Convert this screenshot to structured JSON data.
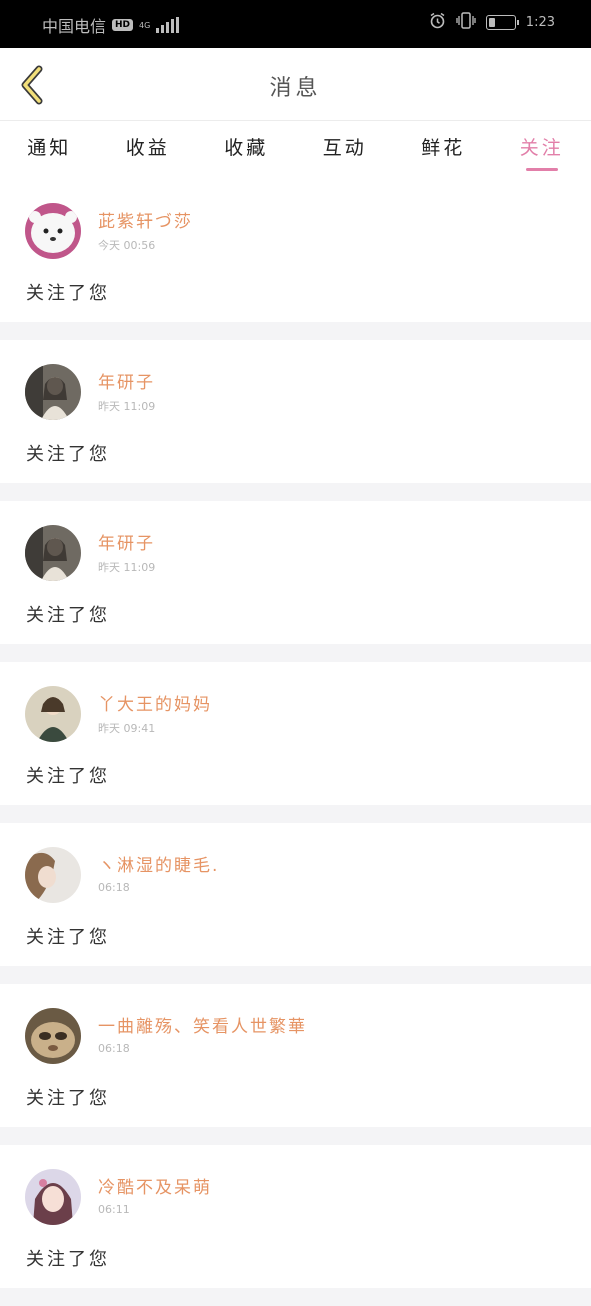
{
  "status_bar": {
    "carrier": "中国电信",
    "hd_badge": "HD",
    "network": "4G",
    "time": "1:23",
    "battery_level": 0.25
  },
  "header": {
    "title": "消息",
    "back_icon": "chevron-left-icon"
  },
  "tabs": [
    {
      "label": "通知",
      "active": false
    },
    {
      "label": "收益",
      "active": false
    },
    {
      "label": "收藏",
      "active": false
    },
    {
      "label": "互动",
      "active": false
    },
    {
      "label": "鲜花",
      "active": false
    },
    {
      "label": "关注",
      "active": true
    }
  ],
  "notifications": [
    {
      "name": "茈紫轩づ莎",
      "time": "今天 00:56",
      "action": "关注了您"
    },
    {
      "name": "年研子",
      "time": "昨天 11:09",
      "action": "关注了您"
    },
    {
      "name": "年研子",
      "time": "昨天 11:09",
      "action": "关注了您"
    },
    {
      "name": "丫大王的妈妈",
      "time": "昨天 09:41",
      "action": "关注了您"
    },
    {
      "name": "ヽ淋湿的睫毛.",
      "time": "06:18",
      "action": "关注了您"
    },
    {
      "name": "一曲離殇、笑看人世繁華",
      "time": "06:18",
      "action": "关注了您"
    },
    {
      "name": "冷酷不及呆萌",
      "time": "06:11",
      "action": "关注了您"
    }
  ],
  "colors": {
    "accent": "#e27fa9",
    "name": "#e69464",
    "divider": "#f4f4f6"
  }
}
